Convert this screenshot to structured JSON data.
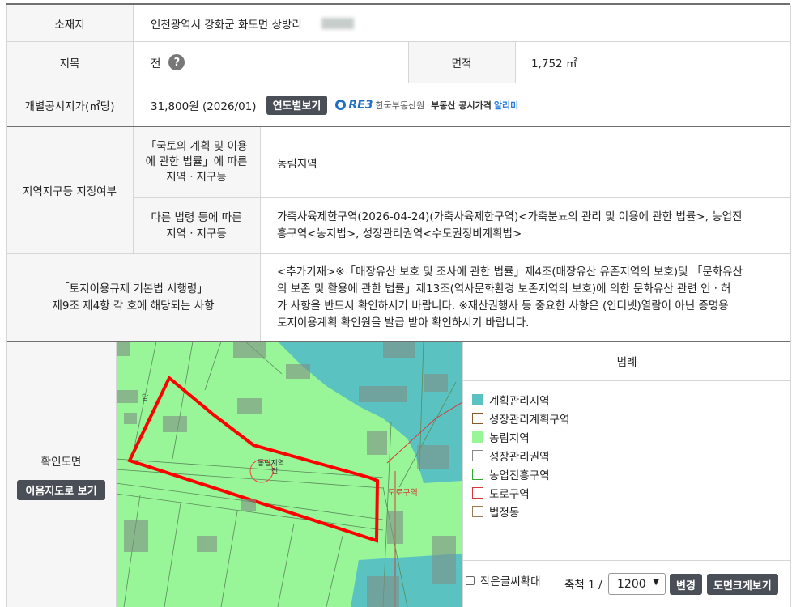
{
  "address": {
    "label": "소재지",
    "value": "인천광역시 강화군 화도면 상방리"
  },
  "jimok": {
    "label": "지목",
    "value": "전"
  },
  "area": {
    "label": "면적",
    "value": "1,752 ㎡"
  },
  "price": {
    "label": "개별공시지가(㎡당)",
    "value": "31,800원 (2026/01)",
    "button": "연도별보기",
    "reb_logo": "RE3",
    "reb_text": "한국부동산원",
    "reb_service": "부동산 공시가격",
    "reb_service_highlight": "알리미"
  },
  "zone": {
    "label": "지역지구등 지정여부",
    "law1_label_l1": "「국토의 계획 및 이용",
    "law1_label_l2": "에 관한 법률」에 따른",
    "law1_label_l3": "지역ㆍ지구등",
    "law1_value": "농림지역",
    "law2_label_l1": "다른 법령 등에 따른",
    "law2_label_l2": "지역ㆍ지구등",
    "law2_value_l1": "가축사육제한구역(2026-04-24)(가축사육제한구역)<가축분뇨의 관리 및 이용에 관한 법률>, 농업진",
    "law2_value_l2": "흥구역<농지법>, 성장관리권역<수도권정비계획법>"
  },
  "regulation": {
    "label_l1": "「토지이용규제 기본법 시행령」",
    "label_l2": "제9조 제4항 각 호에 해당되는 사항",
    "text_l1": "<추가기재>※「매장유산 보호 및 조사에 관한 법률」제4조(매장유산 유존지역의 보호)및 「문화유산",
    "text_l2": "의 보존 및 활용에 관한 법률」제13조(역사문화환경 보존지역의 보호)에 의한 문화유산 관련 인ㆍ허",
    "text_l3": "가 사항을 반드시 확인하시기 바랍니다. ※재산권행사 등 중요한 사항은 (인터넷)열람이 아닌 증명용",
    "text_l4": "토지이용계획 확인원을 발급 받아 확인하시기 바랍니다."
  },
  "map": {
    "label": "확인도면",
    "button": "이음지도로 보기",
    "parcel_label_l1": "동림지역",
    "parcel_label_l2": "전",
    "road_label": "도로구역",
    "small_label": "답"
  },
  "legend": {
    "title": "범례",
    "items": [
      {
        "label": "계획관리지역",
        "fill": "#5bc2c2",
        "border": "#5bc2c2"
      },
      {
        "label": "성장관리계획구역",
        "fill": "#ffffff",
        "border": "#8b5a2b"
      },
      {
        "label": "농림지역",
        "fill": "#98f598",
        "border": "#98f598"
      },
      {
        "label": "성장관리권역",
        "fill": "#ffffff",
        "border": "#888888"
      },
      {
        "label": "농업진흥구역",
        "fill": "#ffffff",
        "border": "#2eaa2e"
      },
      {
        "label": "도로구역",
        "fill": "#ffffff",
        "border": "#d43a3a"
      },
      {
        "label": "법정동",
        "fill": "#ffffff",
        "border": "#9a7a50"
      }
    ]
  },
  "controls": {
    "small_text_label": "작은글씨확대",
    "scale_label": "축척 1 /",
    "scale_value": "1200",
    "change_button": "변경",
    "enlarge_button": "도면크게보기"
  },
  "colors": {
    "header_bg": "#f6f6f6",
    "button_bg": "#4a4e56",
    "highlight": "#2a7de1"
  }
}
